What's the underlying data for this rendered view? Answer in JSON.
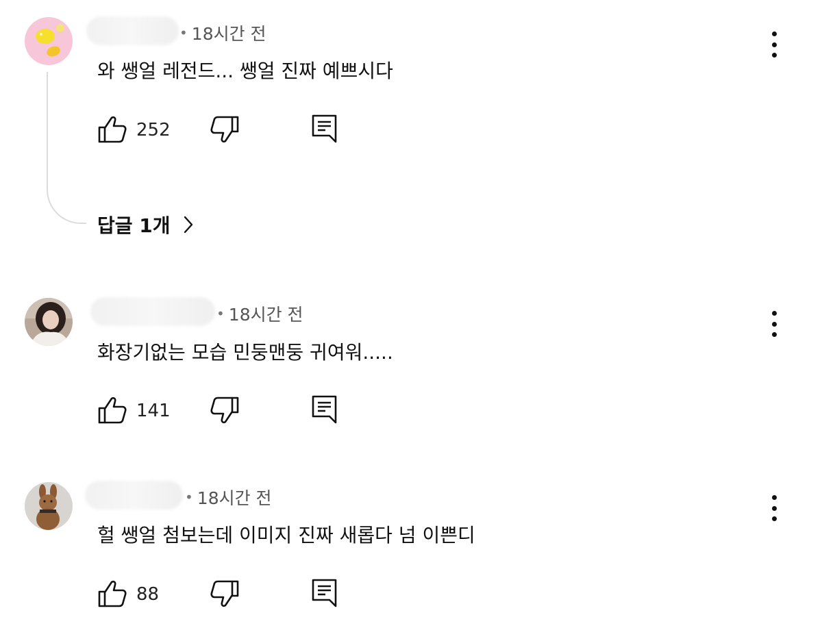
{
  "comments": [
    {
      "timestamp": "18시간 전",
      "text": "와 쌩얼 레전드... 쌩얼 진짜 예쁘시다",
      "likes": "252",
      "replies_label": "답글 1개",
      "avatar": "yellow-fruit-avatar"
    },
    {
      "timestamp": "18시간 전",
      "text": "화장기없는 모습 민둥맨둥 귀여워.....",
      "likes": "141",
      "avatar": "girl-photo-avatar"
    },
    {
      "timestamp": "18시간 전",
      "text": "헐 쌩얼 첨보는데 이미지 진짜 새롭다 넘 이쁜디",
      "likes": "88",
      "avatar": "teddy-bear-avatar"
    }
  ],
  "icons": {
    "like": "thumbs-up-icon",
    "dislike": "thumbs-down-icon",
    "reply": "reply-comment-icon",
    "more": "more-vert-icon",
    "chevron": "chevron-right-icon"
  }
}
